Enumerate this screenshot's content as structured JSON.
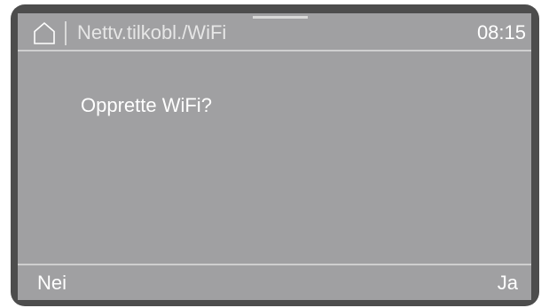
{
  "status_bar": {
    "home_icon": "home-icon",
    "title": "Nettv.tilkobl./WiFi",
    "clock": "08:15"
  },
  "dialog": {
    "question": "Opprette WiFi?"
  },
  "actions": {
    "no_label": "Nei",
    "yes_label": "Ja"
  },
  "colors": {
    "screen_background": "#a0a0a2",
    "bezel": "#4d4d4d",
    "text": "#ffffff",
    "divider": "#cfcfcf"
  }
}
